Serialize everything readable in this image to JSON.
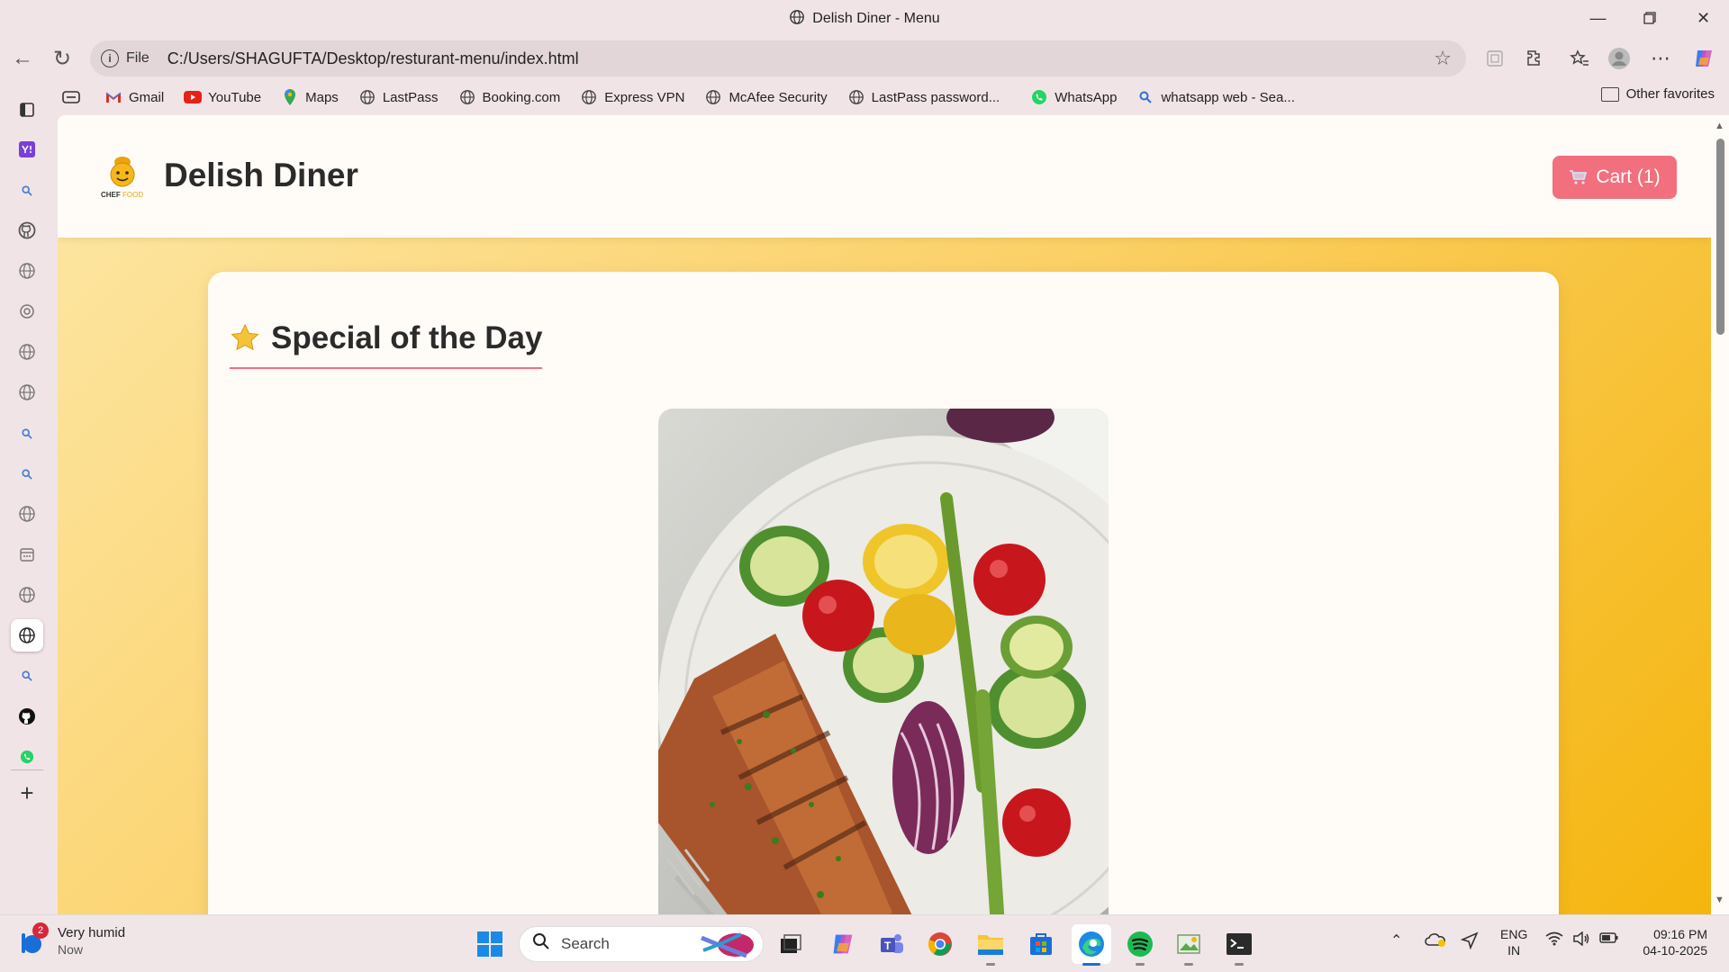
{
  "window": {
    "title": "Delish Diner - Menu"
  },
  "address_bar": {
    "scheme_label": "File",
    "url": "C:/Users/SHAGUFTA/Desktop/resturant-menu/index.html"
  },
  "favorites": [
    {
      "label": "Gmail",
      "icon": "gmail-icon"
    },
    {
      "label": "YouTube",
      "icon": "youtube-icon"
    },
    {
      "label": "Maps",
      "icon": "maps-icon"
    },
    {
      "label": "LastPass",
      "icon": "globe-icon"
    },
    {
      "label": "Booking.com",
      "icon": "globe-icon"
    },
    {
      "label": "Express VPN",
      "icon": "globe-icon"
    },
    {
      "label": "McAfee Security",
      "icon": "globe-icon"
    },
    {
      "label": "LastPass password...",
      "icon": "globe-icon"
    },
    {
      "label": "WhatsApp",
      "icon": "whatsapp-icon"
    },
    {
      "label": "whatsapp web - Sea...",
      "icon": "search-icon"
    }
  ],
  "other_favorites": "Other favorites",
  "site": {
    "name": "Delish Diner",
    "logo_caption": "CHEF FOOD",
    "cart_label": "Cart (1)",
    "section_title": "Special of the Day"
  },
  "taskbar": {
    "weather_badge": "2",
    "weather_text": "Very humid",
    "weather_time": "Now",
    "search_placeholder": "Search",
    "lang_line1": "ENG",
    "lang_line2": "IN",
    "time": "09:16 PM",
    "date": "04-10-2025"
  },
  "colors": {
    "accent": "#f26f7d",
    "page_bg_start": "#fde7a6",
    "page_bg_end": "#f5b50e",
    "card_bg": "#fffcf7"
  }
}
